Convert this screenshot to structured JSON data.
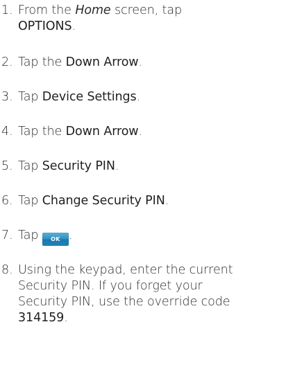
{
  "steps": [
    {
      "num": "1.",
      "pre": "From the ",
      "em": "Home",
      "mid": " screen, tap",
      "bold": "OPTIONS",
      "post": "."
    },
    {
      "num": "2.",
      "pre": "Tap the ",
      "bold": "Down Arrow",
      "post": "."
    },
    {
      "num": "3.",
      "pre": "Tap ",
      "bold": "Device Settings",
      "post": "."
    },
    {
      "num": "4.",
      "pre": "Tap the ",
      "bold": "Down Arrow",
      "post": "."
    },
    {
      "num": "5.",
      "pre": "Tap ",
      "bold": "Security PIN",
      "post": "."
    },
    {
      "num": "6.",
      "pre": "Tap ",
      "bold": "Change Security PIN",
      "post": "."
    },
    {
      "num": "7.",
      "pre": "Tap ",
      "button": "OK",
      "post": "."
    },
    {
      "num": "8.",
      "line1": "Using the keypad, enter the current",
      "line2": "Security PIN. If you forget your",
      "line3": "Security PIN, use the override code",
      "bold": "314159",
      "post": "."
    }
  ],
  "colors": {
    "text": "#2b2b2b",
    "ok_button": "#2d8ec2"
  },
  "icons": {
    "ok_button_icon": "ok-button-icon"
  }
}
